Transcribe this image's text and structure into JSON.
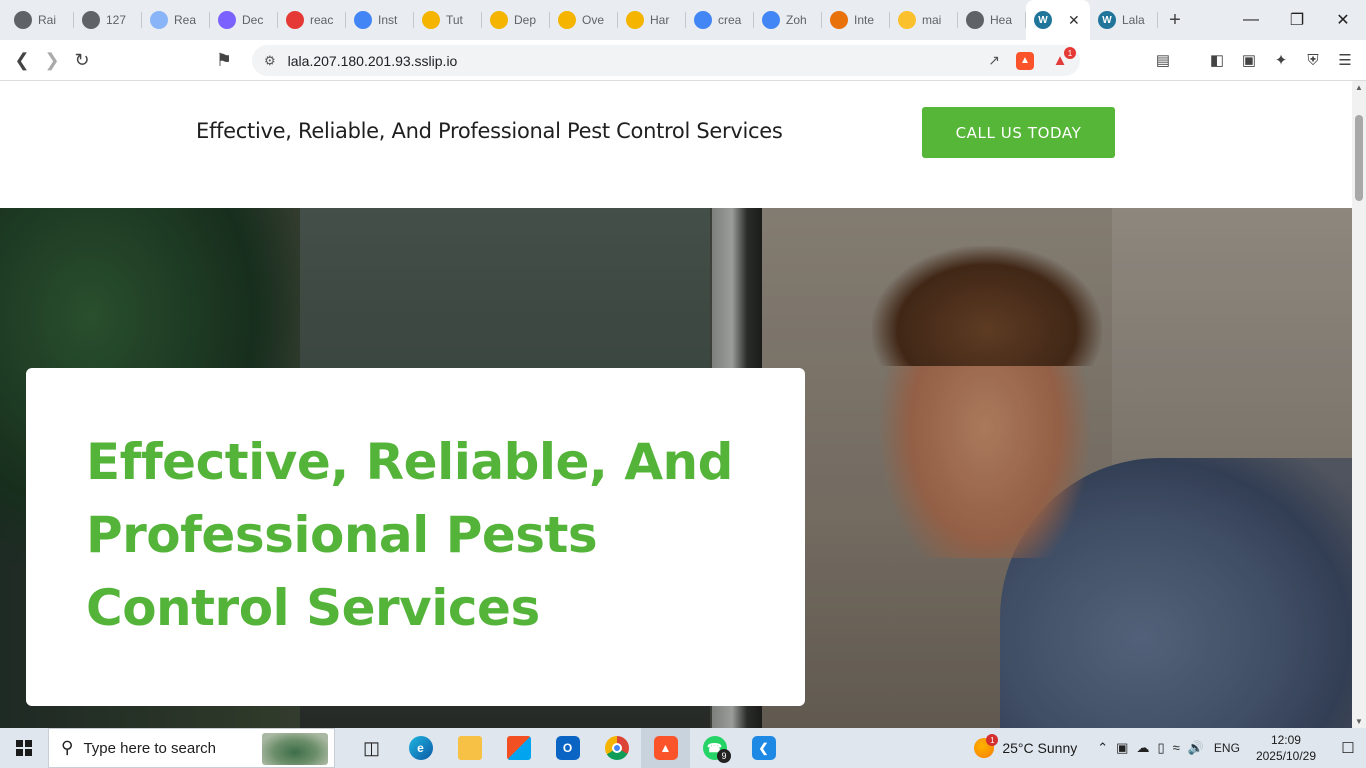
{
  "browser": {
    "tabs": [
      {
        "label": "Rai",
        "icon": "gear-icon",
        "color": "#5f6368"
      },
      {
        "label": "127",
        "icon": "gear-icon",
        "color": "#5f6368"
      },
      {
        "label": "Rea",
        "icon": "rea-icon",
        "color": "#8ab4f8"
      },
      {
        "label": "Dec",
        "icon": "dec-icon",
        "color": "#7b61ff"
      },
      {
        "label": "reac",
        "icon": "reac-icon",
        "color": "#e53935"
      },
      {
        "label": "Inst",
        "icon": "inst-icon",
        "color": "#4285f4"
      },
      {
        "label": "Tut",
        "icon": "microsoft-icon",
        "color": "#f4b400"
      },
      {
        "label": "Dep",
        "icon": "microsoft-icon",
        "color": "#f4b400"
      },
      {
        "label": "Ove",
        "icon": "microsoft-icon",
        "color": "#f4b400"
      },
      {
        "label": "Har",
        "icon": "microsoft-icon",
        "color": "#f4b400"
      },
      {
        "label": "crea",
        "icon": "google-icon",
        "color": "#4285f4"
      },
      {
        "label": "Zoh",
        "icon": "zoho-icon",
        "color": "#4285f4"
      },
      {
        "label": "Inte",
        "icon": "sparkle-icon",
        "color": "#e8710a"
      },
      {
        "label": "mai",
        "icon": "mai-icon",
        "color": "#fbc02d"
      },
      {
        "label": "Hea",
        "icon": "gear-icon",
        "color": "#5f6368"
      },
      {
        "label": "",
        "icon": "wordpress-icon",
        "color": "#21759b",
        "active": true
      },
      {
        "label": "Lala",
        "icon": "wordpress-icon",
        "color": "#21759b"
      }
    ],
    "url": "lala.207.180.201.93.sslip.io",
    "shield_badge": "1"
  },
  "page": {
    "header_tagline": "Effective, Reliable, And Professional Pest Control Services",
    "cta_label": "CALL US TODAY",
    "hero_heading": "Effective, Reliable, And Professional Pests Control Services",
    "accent_color": "#55b638"
  },
  "taskbar": {
    "search_placeholder": "Type here to search",
    "whatsapp_badge": "9",
    "weather_badge": "1",
    "weather": "25°C  Sunny",
    "language": "ENG",
    "time": "12:09",
    "date": "2025/10/29"
  }
}
